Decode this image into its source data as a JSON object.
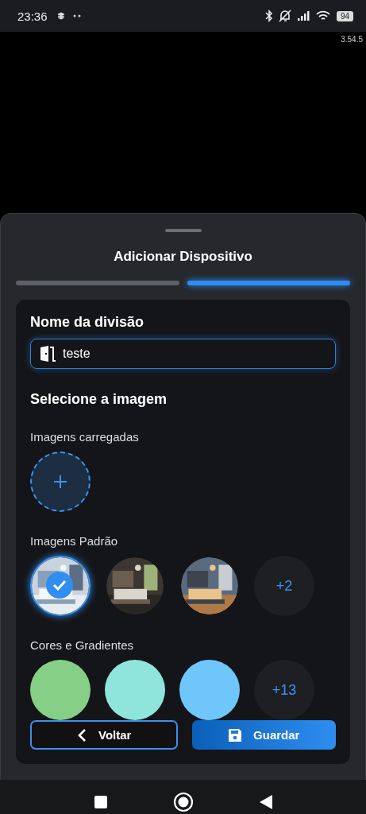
{
  "status_bar": {
    "time": "23:36",
    "battery": "94"
  },
  "background": {
    "version": "3.54.5"
  },
  "sheet": {
    "title": "Adicionar Dispositivo",
    "steps": [
      {
        "active": false
      },
      {
        "active": true
      }
    ],
    "name_label": "Nome da divisão",
    "name_value": "teste",
    "image_heading": "Selecione a imagem",
    "uploaded_label": "Imagens carregadas",
    "default_label": "Imagens Padrão",
    "default_images": [
      {
        "kind": "picture",
        "selected": true
      },
      {
        "kind": "picture",
        "selected": false
      },
      {
        "kind": "picture",
        "selected": false
      }
    ],
    "default_more": "+2",
    "colors_label": "Cores e Gradientes",
    "colors": [
      {
        "color": "#86cf86",
        "selected": false
      },
      {
        "color": "#8fe5dc",
        "selected": false
      },
      {
        "color": "#6ec6fb",
        "selected": false
      }
    ],
    "colors_more": "+13",
    "back_button": "Voltar",
    "save_button": "Guardar"
  }
}
